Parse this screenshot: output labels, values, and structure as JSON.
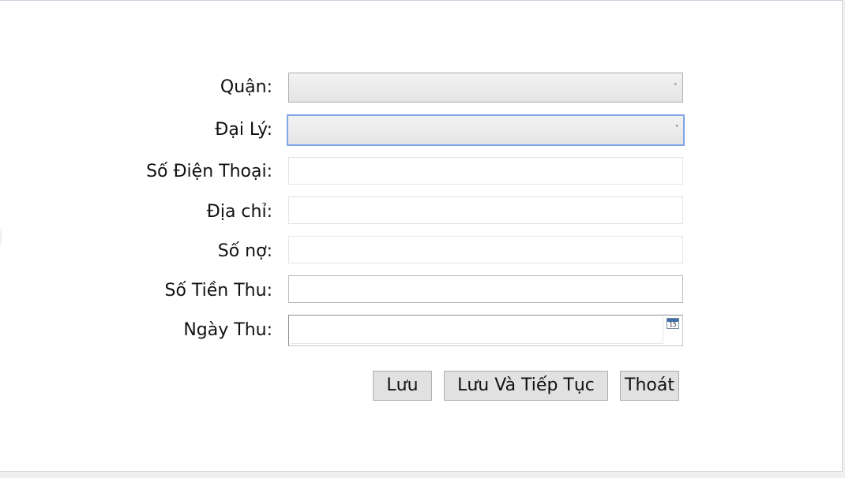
{
  "form": {
    "fields": {
      "quan": {
        "label": "Quận:",
        "value": ""
      },
      "dai_ly": {
        "label": "Đại Lý:",
        "value": ""
      },
      "so_dien_thoai": {
        "label": "Số Điện Thoại:",
        "value": ""
      },
      "dia_chi": {
        "label": "Địa chỉ:",
        "value": ""
      },
      "so_no": {
        "label": "Số nợ:",
        "value": ""
      },
      "so_tien_thu": {
        "label": "Số Tiền Thu:",
        "value": ""
      },
      "ngay_thu": {
        "label": "Ngày Thu:",
        "value": "",
        "calendar_icon_text": "15"
      }
    },
    "buttons": {
      "save_label": "Lưu",
      "save_continue_label": "Lưu Và Tiếp Tục",
      "exit_label": "Thoát"
    },
    "dropdown_arrow_glyph": "ˇ"
  },
  "colors": {
    "focus_border": "#7fa7e6",
    "button_bg": "#e1e1e1",
    "combo_bg": "#e8e8e8",
    "window_bg": "#ffffff"
  }
}
